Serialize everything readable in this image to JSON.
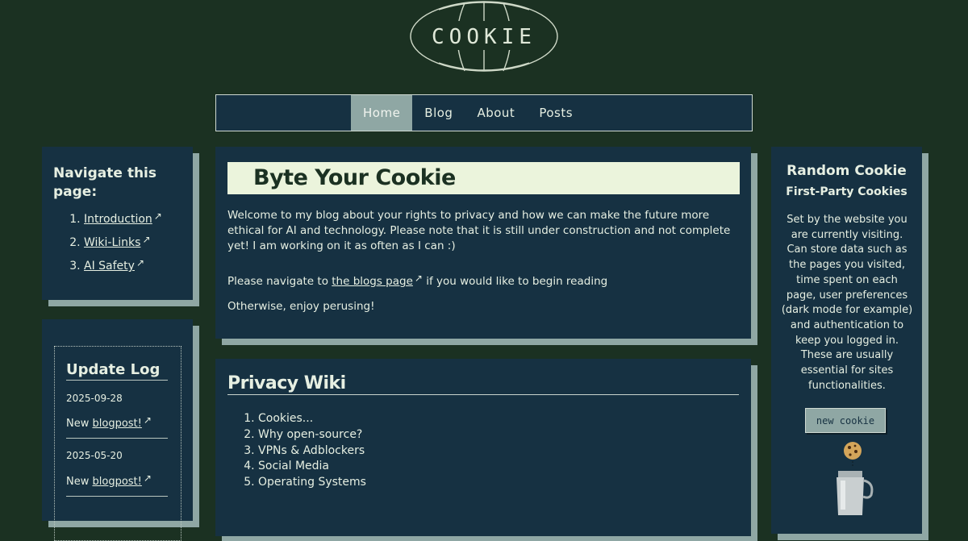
{
  "logo": {
    "text": "COOKIE"
  },
  "nav": {
    "items": [
      "Home",
      "Blog",
      "About",
      "Posts"
    ],
    "active_index": 0
  },
  "page_nav": {
    "title": "Navigate this page:",
    "links": [
      "Introduction",
      "Wiki-Links",
      "AI Safety"
    ]
  },
  "update_log": {
    "title": "Update Log",
    "entries": [
      {
        "date": "2025-09-28",
        "prefix": "New ",
        "link": "blogpost!"
      },
      {
        "date": "2025-05-20",
        "prefix": "New ",
        "link": "blogpost!"
      }
    ]
  },
  "main": {
    "title": "Byte Your Cookie",
    "intro": "Welcome to my blog about your rights to privacy and how we can make the future more ethical for AI and technology. Please note that it is still under construction and not complete yet! I am working on it as often as I can :)",
    "navigate_prefix": "Please navigate to ",
    "navigate_link": "the blogs page",
    "navigate_suffix": " if you would like to begin reading",
    "closing": "Otherwise, enjoy perusing!"
  },
  "wiki": {
    "title": "Privacy Wiki",
    "items": [
      "Cookies...",
      "Why open-source?",
      "VPNs & Adblockers",
      "Social Media",
      "Operating Systems"
    ]
  },
  "random_cookie": {
    "title": "Random Cookie",
    "subtitle": "First-Party Cookies",
    "description": "Set by the website you are currently visiting. Can store data such as the pages you visited, time spent on each page, user preferences (dark mode for example) and authentication to keep you logged in. These are usually essential for sites functionalities.",
    "button": "new cookie"
  },
  "colors": {
    "background": "#1b3122",
    "panel": "#163142",
    "accent": "#8fa7a4",
    "banner": "#ebf4dc",
    "text": "#e6efe2"
  }
}
